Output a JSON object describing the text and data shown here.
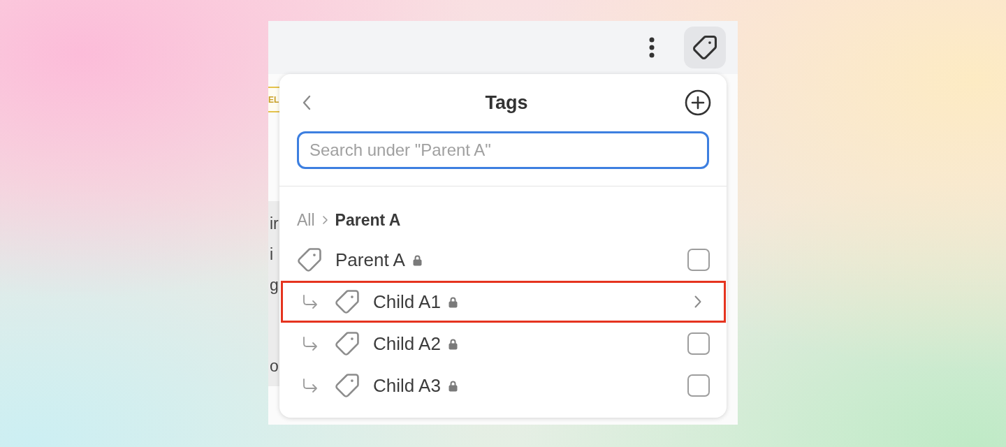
{
  "toolbar": {
    "tag_button": {
      "selected": true
    }
  },
  "background_content": {
    "badge": "EL",
    "fragments": [
      "ir",
      "i",
      "g",
      "o"
    ]
  },
  "popup": {
    "title": "Tags",
    "search": {
      "placeholder": "Search under \"Parent A\""
    },
    "breadcrumb": [
      {
        "label": "All",
        "selected": false
      },
      {
        "label": "Parent A",
        "selected": true
      }
    ],
    "tags": [
      {
        "name": "Parent A",
        "locked": true,
        "kind": "checkbox",
        "checked": false,
        "highlighted": false,
        "children": [
          {
            "name": "Child A1",
            "locked": true,
            "kind": "submenu",
            "highlighted": true
          },
          {
            "name": "Child A2",
            "locked": true,
            "kind": "checkbox",
            "checked": false,
            "highlighted": false
          },
          {
            "name": "Child A3",
            "locked": true,
            "kind": "checkbox",
            "checked": false,
            "highlighted": false
          }
        ]
      }
    ]
  }
}
